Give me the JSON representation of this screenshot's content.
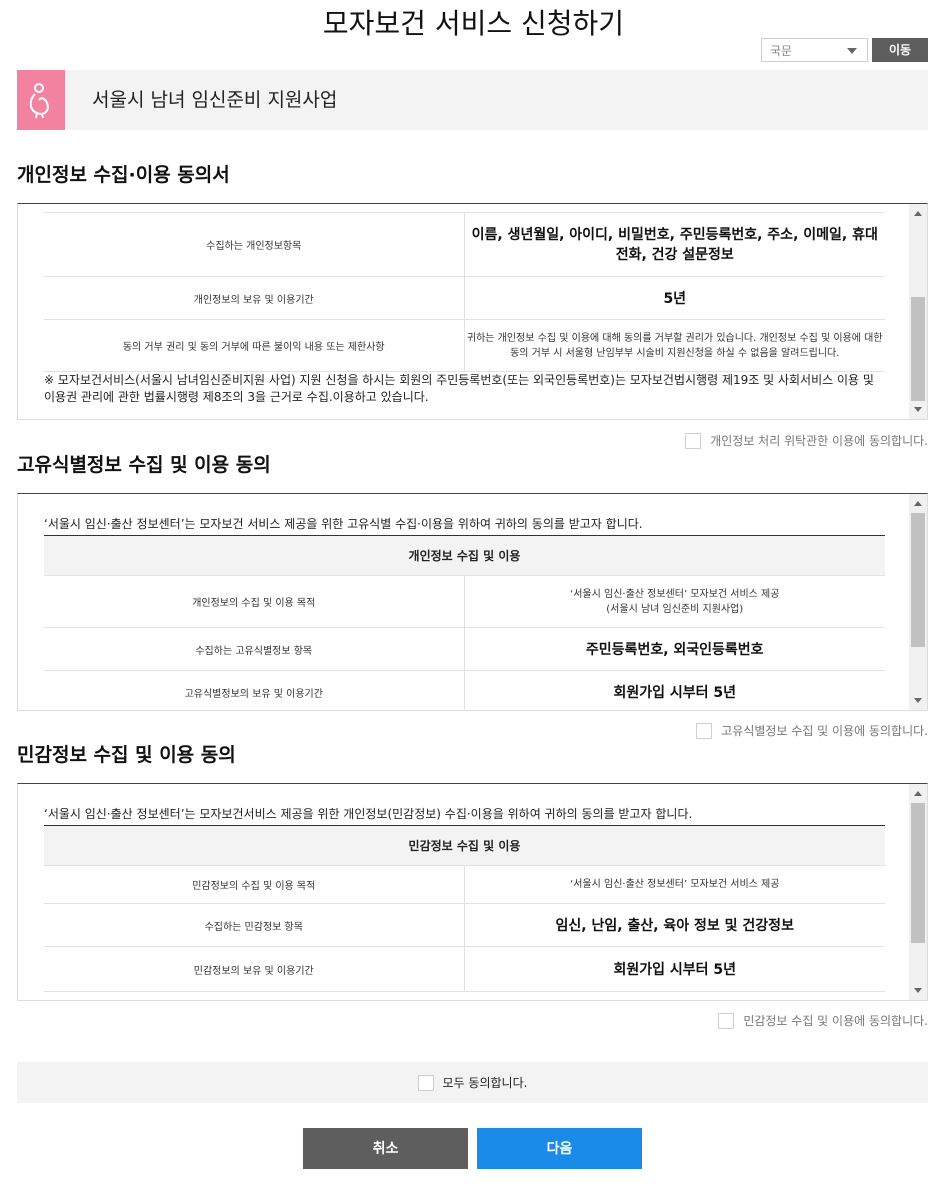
{
  "page": {
    "title": "모자보건 서비스 신청하기"
  },
  "header": {
    "lang_select_value": "국문",
    "go_label": "이동"
  },
  "banner": {
    "title": "서울시 남녀 임신준비 지원사업"
  },
  "colors": {
    "banner_icon_bg": "#f2829f",
    "next_button": "#1a8be8",
    "cancel_button": "#5e5e5e"
  },
  "section1": {
    "title": "개인정보 수집·이용 동의서",
    "rows": [
      {
        "label": "수집하는 개인정보항목",
        "value": "이름, 생년월일, 아이디, 비밀번호, 주민등록번호, 주소, 이메일, 휴대전화, 건강 설문정보"
      },
      {
        "label": "개인정보의 보유 및 이용기간",
        "value": "5년"
      },
      {
        "label": "동의 거부 권리 및 동의 거부에 따른 불이익 내용 또는 제한사항",
        "value": "귀하는 개인정보 수집 및 이용에 대해 동의를 거부할 권리가 있습니다. 개인정보 수집 및 이용에 대한 동의 거부 시 서울형 난임부부 시술비 지원신청을 하실 수 없음을 알려드립니다."
      }
    ],
    "note": "※ 모자보건서비스(서울시 남녀임신준비지원 사업) 지원 신청을 하시는 회원의 주민등록번호(또는 외국인등록번호)는 모자보건법시행령 제19조 및 사회서비스 이용 및 이용권 관리에 관한 법률시행령 제8조의 3을 근거로 수집.이용하고 있습니다.",
    "agree_label": "개인정보 처리 위탁관한 이용에 동의합니다."
  },
  "section2": {
    "title": "고유식별정보 수집 및 이용 동의",
    "intro": "‘서울시 임신·출산 정보센터’는 모자보건 서비스 제공을 위한 고유식별 수집·이용을 위하여 귀하의 동의를 받고자 합니다.",
    "table_header": "개인정보 수집 및 이용",
    "rows": [
      {
        "label": "개인정보의 수집 및 이용 목적",
        "value": "‘서울시 임신·출산 정보센터’ 모자보건 서비스 제공",
        "value2": "(서울시 남녀 임신준비 지원사업)"
      },
      {
        "label": "수집하는 고유식별정보 항목",
        "value": "주민등록번호, 외국인등록번호"
      },
      {
        "label": "고유식별정보의 보유 및 이용기간",
        "value": "회원가입 시부터 5년"
      }
    ],
    "agree_label": "고유식별정보 수집 및 이용에 동의합니다."
  },
  "section3": {
    "title": "민감정보 수집 및 이용 동의",
    "intro": "‘서울시 임신·출산 정보센터’는 모자보건서비스 제공을 위한 개인정보(민감정보) 수집·이용을 위하여 귀하의 동의를 받고자 합니다.",
    "table_header": "민감정보 수집 및 이용",
    "rows": [
      {
        "label": "민감정보의 수집 및 이용 목적",
        "value": "‘서울시 임신·출산 정보센터’ 모자보건 서비스 제공"
      },
      {
        "label": "수집하는 민감정보 항목",
        "value": "임신, 난임, 출산, 육아 정보 및 건강정보"
      },
      {
        "label": "민감정보의 보유 및 이용기간",
        "value": "회원가입 시부터 5년"
      }
    ],
    "agree_label": "민감정보 수집 및 이용에 동의합니다."
  },
  "all_agree_label": "모두 동의합니다.",
  "buttons": {
    "cancel": "취소",
    "next": "다음"
  }
}
